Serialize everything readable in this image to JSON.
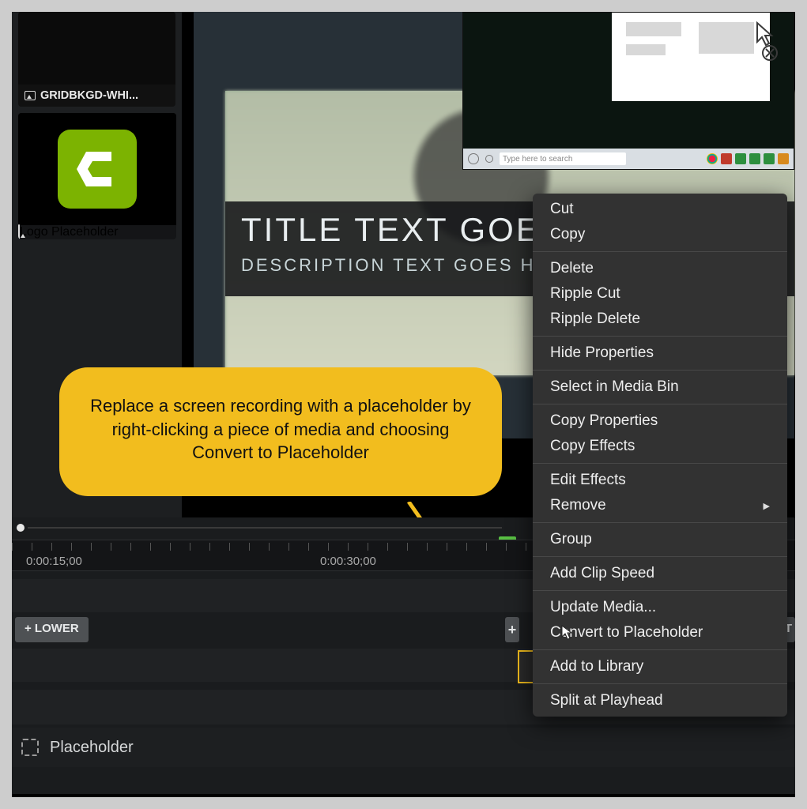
{
  "media_bin": {
    "items": [
      {
        "label": "GRIDBKGD-WHI..."
      },
      {
        "label": "Logo Placeholder"
      }
    ]
  },
  "preview": {
    "title": "TITLE TEXT GOE",
    "description": "DESCRIPTION TEXT GOES HE",
    "taskbar_search_placeholder": "Type here to search"
  },
  "callout": {
    "text": "Replace a screen recording with a placeholder by right-clicking a piece of media and choosing Convert to Placeholder"
  },
  "timeline": {
    "ticks": [
      "0:00:15;00",
      "0:00:30;00"
    ],
    "clip_lower_label": "+  LOWER",
    "clip_plus_label": "+",
    "clip_right_label": "UT",
    "placeholder_track_label": "Placeholder"
  },
  "context_menu": {
    "items": [
      {
        "label": "Cut"
      },
      {
        "label": "Copy"
      },
      {
        "sep": true
      },
      {
        "label": "Delete"
      },
      {
        "label": "Ripple Cut"
      },
      {
        "label": "Ripple Delete"
      },
      {
        "sep": true
      },
      {
        "label": "Hide Properties"
      },
      {
        "sep": true
      },
      {
        "label": "Select in Media Bin"
      },
      {
        "sep": true
      },
      {
        "label": "Copy Properties"
      },
      {
        "label": "Copy Effects"
      },
      {
        "sep": true
      },
      {
        "label": "Edit Effects"
      },
      {
        "label": "Remove",
        "submenu": true
      },
      {
        "sep": true
      },
      {
        "label": "Group"
      },
      {
        "sep": true
      },
      {
        "label": "Add Clip Speed"
      },
      {
        "sep": true
      },
      {
        "label": "Update Media..."
      },
      {
        "label": "Convert to Placeholder",
        "cursor": true
      },
      {
        "sep": true
      },
      {
        "label": "Add to Library"
      },
      {
        "sep": true
      },
      {
        "label": "Split at Playhead"
      }
    ]
  }
}
